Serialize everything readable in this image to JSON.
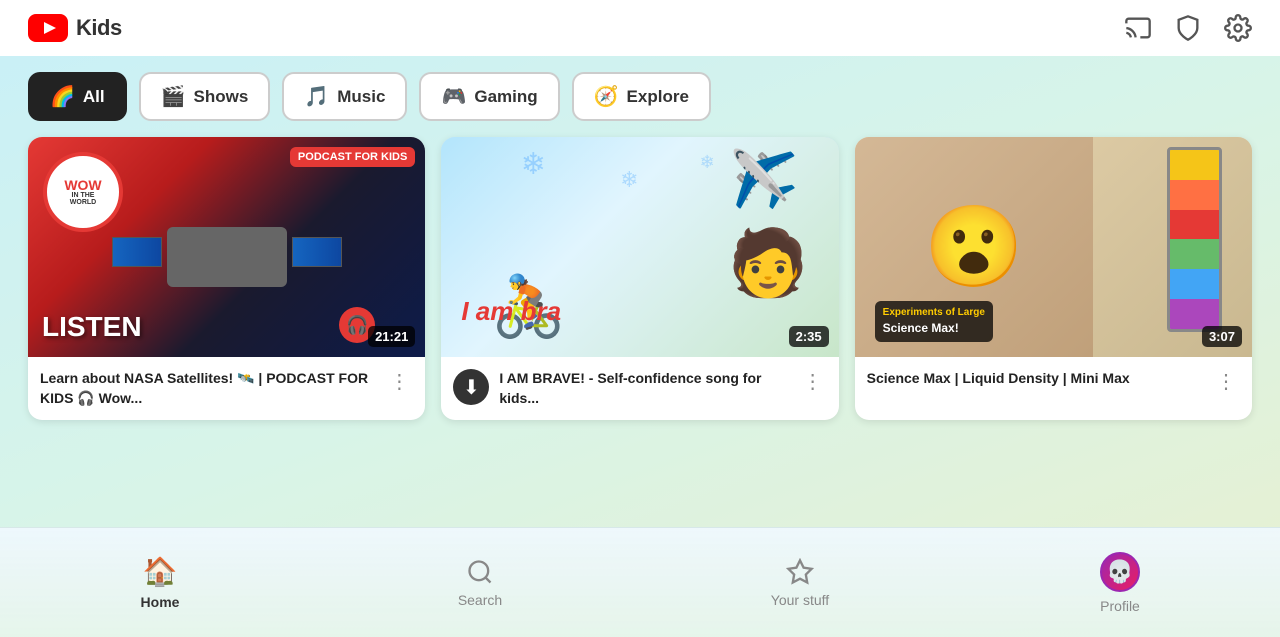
{
  "header": {
    "logo_text": "Kids",
    "icons": {
      "cast": "cast-icon",
      "shield": "shield-icon",
      "settings": "settings-icon"
    }
  },
  "categories": [
    {
      "id": "all",
      "label": "All",
      "icon": "🌈",
      "active": true
    },
    {
      "id": "shows",
      "label": "Shows",
      "icon": "🎬",
      "active": false
    },
    {
      "id": "music",
      "label": "Music",
      "icon": "🎵",
      "active": false
    },
    {
      "id": "gaming",
      "label": "Gaming",
      "icon": "🎮",
      "active": false
    },
    {
      "id": "explore",
      "label": "Explore",
      "icon": "🧭",
      "active": false
    }
  ],
  "videos": [
    {
      "id": "nasa",
      "title": "Learn about NASA Satellites! 🛰️ | PODCAST FOR KIDS 🎧 Wow...",
      "duration": "21:21",
      "badge": "PODCAST FOR KIDS",
      "listen_text": "LISTEN"
    },
    {
      "id": "brave",
      "title": "I AM BRAVE! - Self-confidence song for kids...",
      "duration": "2:35",
      "has_download": true
    },
    {
      "id": "science",
      "title": "Science Max | Liquid Density | Mini Max",
      "duration": "3:07"
    }
  ],
  "bottom_nav": [
    {
      "id": "home",
      "label": "Home",
      "icon": "🏠",
      "active": true
    },
    {
      "id": "search",
      "label": "Search",
      "icon": "🔍",
      "active": false
    },
    {
      "id": "stuff",
      "label": "Your stuff",
      "icon": "☆",
      "active": false
    },
    {
      "id": "profile",
      "label": "Profile",
      "icon": "👤",
      "active": false,
      "is_avatar": true
    }
  ]
}
